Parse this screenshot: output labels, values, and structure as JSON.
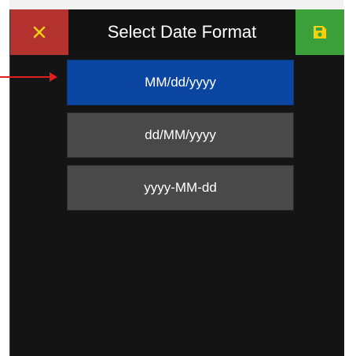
{
  "header": {
    "title": "Select Date Format",
    "close_icon": "close-x-icon",
    "save_icon": "floppy-disk-save-icon",
    "close_color": "#b3312e",
    "save_color": "#3ca03a"
  },
  "options": [
    {
      "label": "MM/dd/yyyy",
      "selected": true
    },
    {
      "label": "dd/MM/yyyy",
      "selected": false
    },
    {
      "label": "yyyy-MM-dd",
      "selected": false
    }
  ],
  "colors": {
    "selected": "#0b46a3",
    "unselected": "#494949",
    "background": "#141414",
    "annotation_arrow": "#e02020"
  }
}
